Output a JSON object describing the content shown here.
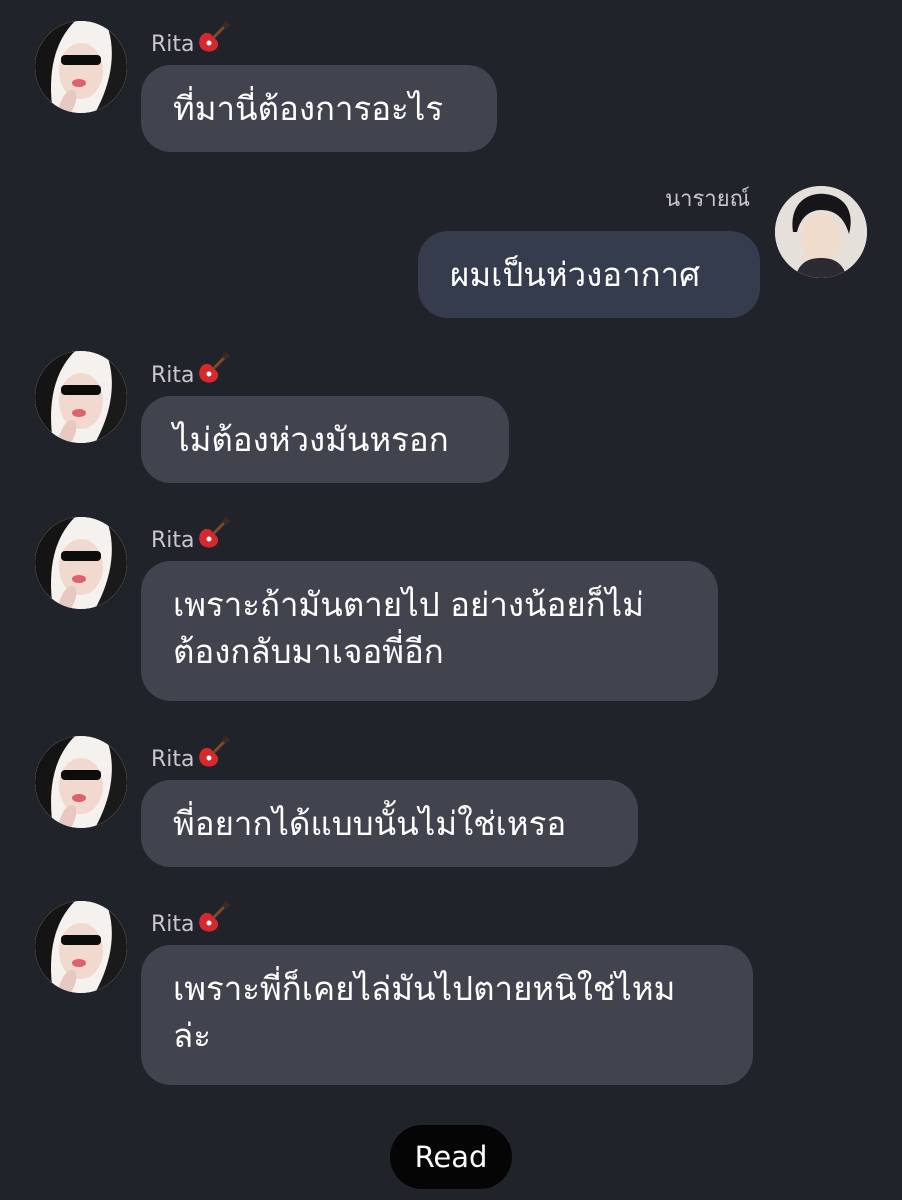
{
  "contact": {
    "name": "Rita",
    "name_icon": "guitar-icon"
  },
  "me": {
    "name": "นารายณ์"
  },
  "messages": [
    {
      "sender": "Rita",
      "text": "ที่มานี่ต้องการอะไร"
    },
    {
      "sender": "นารายณ์",
      "text": "ผมเป็นห่วงอากาศ"
    },
    {
      "sender": "Rita",
      "text": "ไม่ต้องห่วงมันหรอก"
    },
    {
      "sender": "Rita",
      "text": "เพราะถ้ามันตายไป อย่างน้อยก็ไม่\nต้องกลับมาเจอพี่อีก"
    },
    {
      "sender": "Rita",
      "text": "พี่อยากได้แบบนั้นไม่ใช่เหรอ"
    },
    {
      "sender": "Rita",
      "text": "เพราะพี่ก็เคยไล่มันไปตายหนิใช่ไหม\nล่ะ"
    }
  ],
  "status": {
    "read_label": "Read"
  },
  "colors": {
    "background": "#21232a",
    "incoming_bubble": "#41444e",
    "outgoing_bubble": "#353c4d",
    "name_text": "#c7c8cc",
    "read_pill": "#050506"
  }
}
